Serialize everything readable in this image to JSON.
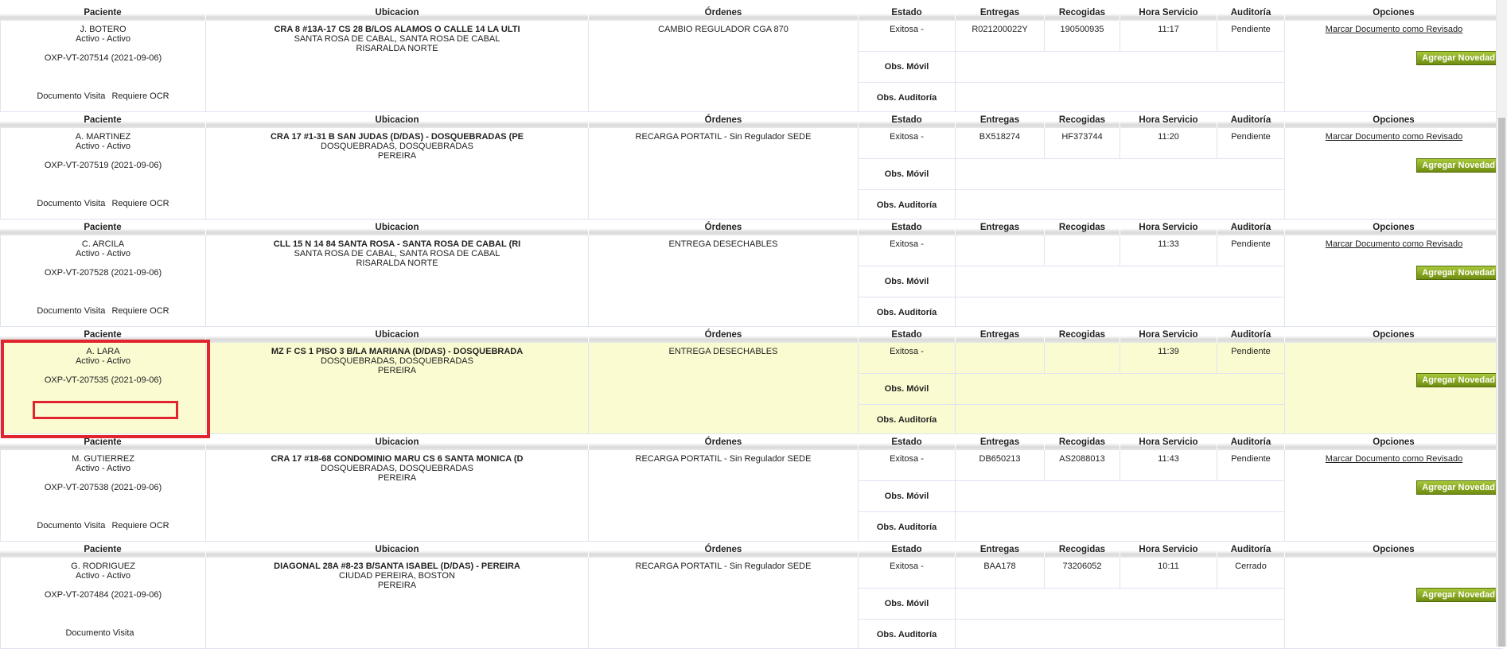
{
  "headers": {
    "paciente": "Paciente",
    "ubicacion": "Ubicacion",
    "ordenes": "Órdenes",
    "estado": "Estado",
    "entregas": "Entregas",
    "recogidas": "Recogidas",
    "hora": "Hora Servicio",
    "auditoria": "Auditoría",
    "opciones": "Opciones"
  },
  "labels": {
    "obs_movil": "Obs. Móvil",
    "obs_auditoria": "Obs. Auditoría",
    "marcar": "Marcar Documento como Revisado",
    "agregar": "Agregar Novedad",
    "doc_visita": "Documento Visita",
    "req_ocr": "Requiere OCR"
  },
  "records": [
    {
      "nombre": "J. BOTERO",
      "estado_paciente": "Activo - Activo",
      "codigo": "OXP-VT-207514 (2021-09-06)",
      "ubicacion": [
        "CRA 8 #13A-17 CS 28 B/LOS ALAMOS O CALLE 14 LA ULTI",
        "SANTA ROSA DE CABAL, SANTA ROSA DE CABAL",
        "RISARALDA NORTE"
      ],
      "orden": "CAMBIO REGULADOR CGA 870",
      "estado": "Exitosa -",
      "entregas": "R021200022Y",
      "recogidas": "190500935",
      "hora": "11:17",
      "auditoria": "Pendiente",
      "doc_visita": "Documento Visita",
      "req_ocr": "Requiere OCR",
      "marcar": "Marcar Documento como Revisado",
      "highlight": false
    },
    {
      "nombre": "A. MARTINEZ",
      "estado_paciente": "Activo - Activo",
      "codigo": "OXP-VT-207519 (2021-09-06)",
      "ubicacion": [
        "CRA 17 #1-31 B SAN JUDAS (D/DAS) - DOSQUEBRADAS (PE",
        "DOSQUEBRADAS, DOSQUEBRADAS",
        "PEREIRA"
      ],
      "orden": "RECARGA PORTATIL - Sin Regulador SEDE",
      "estado": "Exitosa -",
      "entregas": "BX518274",
      "recogidas": "HF373744",
      "hora": "11:20",
      "auditoria": "Pendiente",
      "doc_visita": "Documento Visita",
      "req_ocr": "Requiere OCR",
      "marcar": "Marcar Documento como Revisado",
      "highlight": false
    },
    {
      "nombre": "C. ARCILA",
      "estado_paciente": "Activo - Activo",
      "codigo": "OXP-VT-207528 (2021-09-06)",
      "ubicacion": [
        "CLL 15 N 14 84 SANTA ROSA - SANTA ROSA DE CABAL (RI",
        "SANTA ROSA DE CABAL, SANTA ROSA DE CABAL",
        "RISARALDA NORTE"
      ],
      "orden": "ENTREGA DESECHABLES",
      "estado": "Exitosa -",
      "entregas": "",
      "recogidas": "",
      "hora": "11:33",
      "auditoria": "Pendiente",
      "doc_visita": "Documento Visita",
      "req_ocr": "Requiere OCR",
      "marcar": "Marcar Documento como Revisado",
      "highlight": false
    },
    {
      "nombre": "A. LARA",
      "estado_paciente": "Activo - Activo",
      "codigo": "OXP-VT-207535 (2021-09-06)",
      "ubicacion": [
        "MZ F CS 1 PISO 3 B/LA MARIANA (D/DAS) - DOSQUEBRADA",
        "DOSQUEBRADAS, DOSQUEBRADAS",
        "PEREIRA"
      ],
      "orden": "ENTREGA DESECHABLES",
      "estado": "Exitosa -",
      "entregas": "",
      "recogidas": "",
      "hora": "11:39",
      "auditoria": "Pendiente",
      "doc_visita": "",
      "req_ocr": "",
      "marcar": "",
      "highlight": true
    },
    {
      "nombre": "M. GUTIERREZ",
      "estado_paciente": "Activo - Activo",
      "codigo": "OXP-VT-207538 (2021-09-06)",
      "ubicacion": [
        "CRA 17 #18-68 CONDOMINIO MARU CS 6 SANTA MONICA (D",
        "DOSQUEBRADAS, DOSQUEBRADAS",
        "PEREIRA"
      ],
      "orden": "RECARGA PORTATIL - Sin Regulador SEDE",
      "estado": "Exitosa -",
      "entregas": "DB650213",
      "recogidas": "AS2088013",
      "hora": "11:43",
      "auditoria": "Pendiente",
      "doc_visita": "Documento Visita",
      "req_ocr": "Requiere OCR",
      "marcar": "Marcar Documento como Revisado",
      "highlight": false
    },
    {
      "nombre": "G. RODRIGUEZ",
      "estado_paciente": "Activo - Activo",
      "codigo": "OXP-VT-207484 (2021-09-06)",
      "ubicacion": [
        "DIAGONAL 28A #8-23 B/SANTA ISABEL (D/DAS) - PEREIRA",
        "CIUDAD PEREIRA, BOSTON",
        "PEREIRA"
      ],
      "orden": "RECARGA PORTATIL - Sin Regulador SEDE",
      "estado": "Exitosa -",
      "entregas": "BAA178",
      "recogidas": "73206052",
      "hora": "10:11",
      "auditoria": "Cerrado",
      "doc_visita": "Documento Visita",
      "req_ocr": "",
      "marcar": "",
      "highlight": false
    }
  ]
}
